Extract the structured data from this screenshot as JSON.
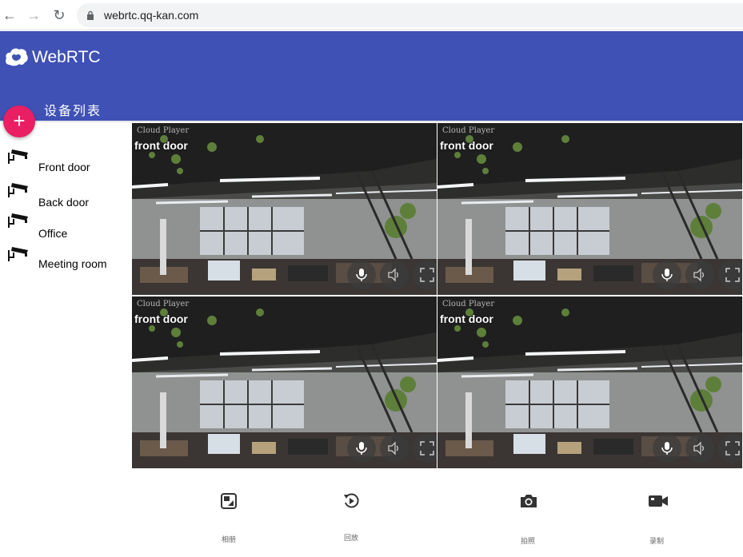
{
  "browser": {
    "url": "webrtc.qq-kan.com"
  },
  "app": {
    "title": "WebRTC",
    "device_list_title": "设备列表",
    "add_button_label": "+"
  },
  "devices": [
    {
      "name": "Front door"
    },
    {
      "name": "Back door"
    },
    {
      "name": "Office"
    },
    {
      "name": "Meeting room"
    }
  ],
  "tiles": [
    {
      "watermark": "Cloud Player",
      "label": "front door"
    },
    {
      "watermark": "Cloud Player",
      "label": "front door"
    },
    {
      "watermark": "Cloud Player",
      "label": "front door"
    },
    {
      "watermark": "Cloud Player",
      "label": "front door"
    }
  ],
  "toolbar": {
    "album_label": "相册",
    "playback_label": "回放",
    "snapshot_label": "拍照",
    "record_label": "录制"
  },
  "colors": {
    "header": "#3f51b5",
    "fab": "#e91e63"
  }
}
